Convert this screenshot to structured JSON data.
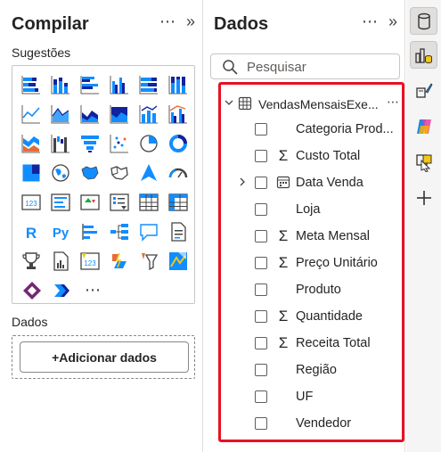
{
  "build_pane": {
    "title": "Compilar",
    "more_icon": "⋯",
    "collapse_icon": "»",
    "suggestions_label": "Sugestões",
    "visuals": [
      [
        "stacked-bar-chart-icon",
        "stacked-column-chart-icon",
        "clustered-bar-chart-icon",
        "clustered-column-chart-icon",
        "100-stacked-bar-chart-icon",
        "100-stacked-column-chart-icon"
      ],
      [
        "line-chart-icon",
        "area-chart-icon",
        "stacked-area-chart-icon",
        "100-stacked-area-chart-icon",
        "line-and-column-chart-icon",
        "line-and-clustered-column-chart-icon"
      ],
      [
        "ribbon-chart-icon",
        "waterfall-chart-icon",
        "funnel-chart-icon",
        "scatter-chart-icon",
        "pie-chart-icon",
        "donut-chart-icon"
      ],
      [
        "treemap-icon",
        "map-icon",
        "filled-map-icon",
        "shape-map-icon",
        "azure-map-icon",
        "gauge-icon"
      ],
      [
        "card-icon",
        "multi-row-card-icon",
        "kpi-icon",
        "slicer-icon",
        "table-icon",
        "matrix-icon"
      ],
      [
        "r-visual-icon",
        "python-visual-icon",
        "key-influencers-icon",
        "decomposition-tree-icon",
        "qa-icon",
        "smart-narrative-icon"
      ],
      [
        "metrics-icon",
        "paginated-report-icon",
        "power-apps-icon",
        "power-automate-icon",
        "slicer-new-icon",
        "azure-maps-icon"
      ],
      [
        "power-apps-diamond-icon",
        "chevron-arrow-icon",
        "more-visuals-icon"
      ]
    ],
    "more_visuals_text": "⋯",
    "data_label": "Dados",
    "add_data_button": "+Adicionar dados"
  },
  "data_pane": {
    "title": "Dados",
    "more_icon": "⋯",
    "collapse_icon": "»",
    "search_placeholder": "Pesquisar",
    "table": {
      "name": "VendasMensaisExe...",
      "more": "⋯",
      "chevron": "⌄",
      "fields": [
        {
          "name": "Categoria Prod...",
          "icon": "",
          "expandable": false
        },
        {
          "name": "Custo Total",
          "icon": "Σ",
          "expandable": false
        },
        {
          "name": "Data Venda",
          "icon": "calendar",
          "expandable": true
        },
        {
          "name": "Loja",
          "icon": "",
          "expandable": false
        },
        {
          "name": "Meta Mensal",
          "icon": "Σ",
          "expandable": false
        },
        {
          "name": "Preço Unitário",
          "icon": "Σ",
          "expandable": false
        },
        {
          "name": "Produto",
          "icon": "",
          "expandable": false
        },
        {
          "name": "Quantidade",
          "icon": "Σ",
          "expandable": false
        },
        {
          "name": "Receita Total",
          "icon": "Σ",
          "expandable": false
        },
        {
          "name": "Região",
          "icon": "",
          "expandable": false
        },
        {
          "name": "UF",
          "icon": "",
          "expandable": false
        },
        {
          "name": "Vendedor",
          "icon": "",
          "expandable": false
        }
      ]
    }
  },
  "rail": {
    "items": [
      "database-icon",
      "build-visual-icon",
      "format-brush-icon",
      "copilot-icon",
      "filter-pointer-icon",
      "add-icon"
    ]
  },
  "colors": {
    "highlight_border": "#e81123",
    "accent_blue": "#118dff",
    "dark_blue": "#12239e",
    "orange": "#e66c37",
    "yellow": "#f2c811"
  }
}
